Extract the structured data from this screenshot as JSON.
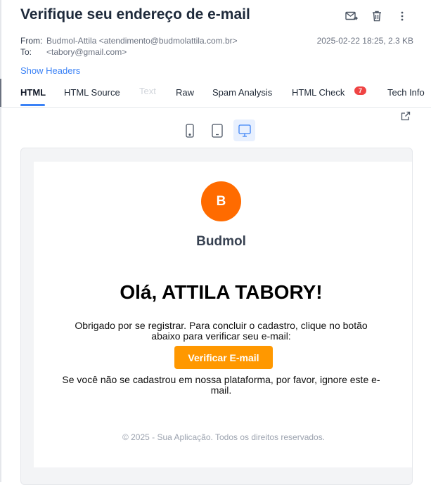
{
  "email": {
    "subject": "Verifique seu endereço de e-mail",
    "from_label": "From:",
    "from_value": "Budmol-Attila <atendimento@budmolattila.com.br>",
    "to_label": "To:",
    "to_value": "<tabory@gmail.com>",
    "date_size": "2025-02-22 18:25, 2.3 KB",
    "show_headers": "Show Headers"
  },
  "actions": {
    "icons": [
      "forward-mail-icon",
      "trash-icon",
      "more-vertical-icon"
    ]
  },
  "tabs": [
    {
      "label": "HTML",
      "state": "active"
    },
    {
      "label": "HTML Source",
      "state": "normal"
    },
    {
      "label": "Text",
      "state": "disabled"
    },
    {
      "label": "Raw",
      "state": "normal"
    },
    {
      "label": "Spam Analysis",
      "state": "normal"
    },
    {
      "label": "HTML Check",
      "state": "normal",
      "badge": "7"
    },
    {
      "label": "Tech Info",
      "state": "normal"
    }
  ],
  "devices": {
    "options": [
      "mobile",
      "tablet",
      "desktop"
    ],
    "selected": "desktop"
  },
  "message": {
    "logo_letter": "B",
    "brand": "Budmol",
    "greeting": "Olá, ATTILA TABORY!",
    "body": "Obrigado por se registrar. Para concluir o cadastro, clique no botão abaixo para verificar seu e-mail:",
    "button": "Verificar E-mail",
    "note": "Se você não se cadastrou em nossa plataforma, por favor, ignore este e-mail.",
    "footer": "© 2025 - Sua Aplicação. Todos os direitos reservados."
  },
  "colors": {
    "accent": "#3b82f6",
    "logo_bg": "#ff6b00",
    "button_bg": "#ff9800",
    "badge_bg": "#ef4444"
  }
}
